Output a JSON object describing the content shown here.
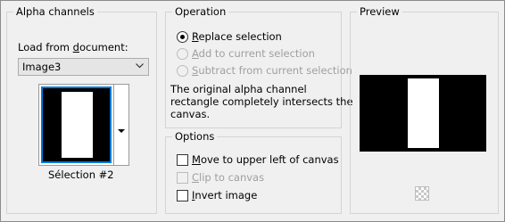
{
  "alpha_channels": {
    "title": "Alpha channels",
    "load_label_pre": "Load from ",
    "load_label_u": "d",
    "load_label_post": "ocument:",
    "document_value": "Image3",
    "selection_name": "Sélection #2"
  },
  "operation": {
    "title": "Operation",
    "replace": {
      "u": "R",
      "rest": "eplace selection",
      "checked": true,
      "enabled": true
    },
    "add": {
      "u": "A",
      "rest": "dd to current selection",
      "checked": false,
      "enabled": false
    },
    "subtract": {
      "u": "S",
      "rest": "ubtract from current selection",
      "checked": false,
      "enabled": false
    },
    "info_line1": "The original alpha channel",
    "info_line2": "rectangle completely intersects the",
    "info_line3": "canvas."
  },
  "options": {
    "title": "Options",
    "move": {
      "u": "M",
      "rest": "ove to upper left of canvas",
      "checked": false,
      "enabled": true
    },
    "clip": {
      "u": "C",
      "rest": "lip to canvas",
      "checked": false,
      "enabled": false
    },
    "invert": {
      "u": "I",
      "rest": "nvert image",
      "checked": false,
      "enabled": true
    }
  },
  "preview": {
    "title": "Preview"
  },
  "icons": {
    "select_chevron": "chevron-down-icon",
    "thumb_dropdown": "triangle-down-icon",
    "transparency": "checkerboard-icon"
  },
  "colors": {
    "selection_accent": "#0078d7",
    "alpha_fill": "#000000",
    "alpha_selected": "#ffffff"
  }
}
